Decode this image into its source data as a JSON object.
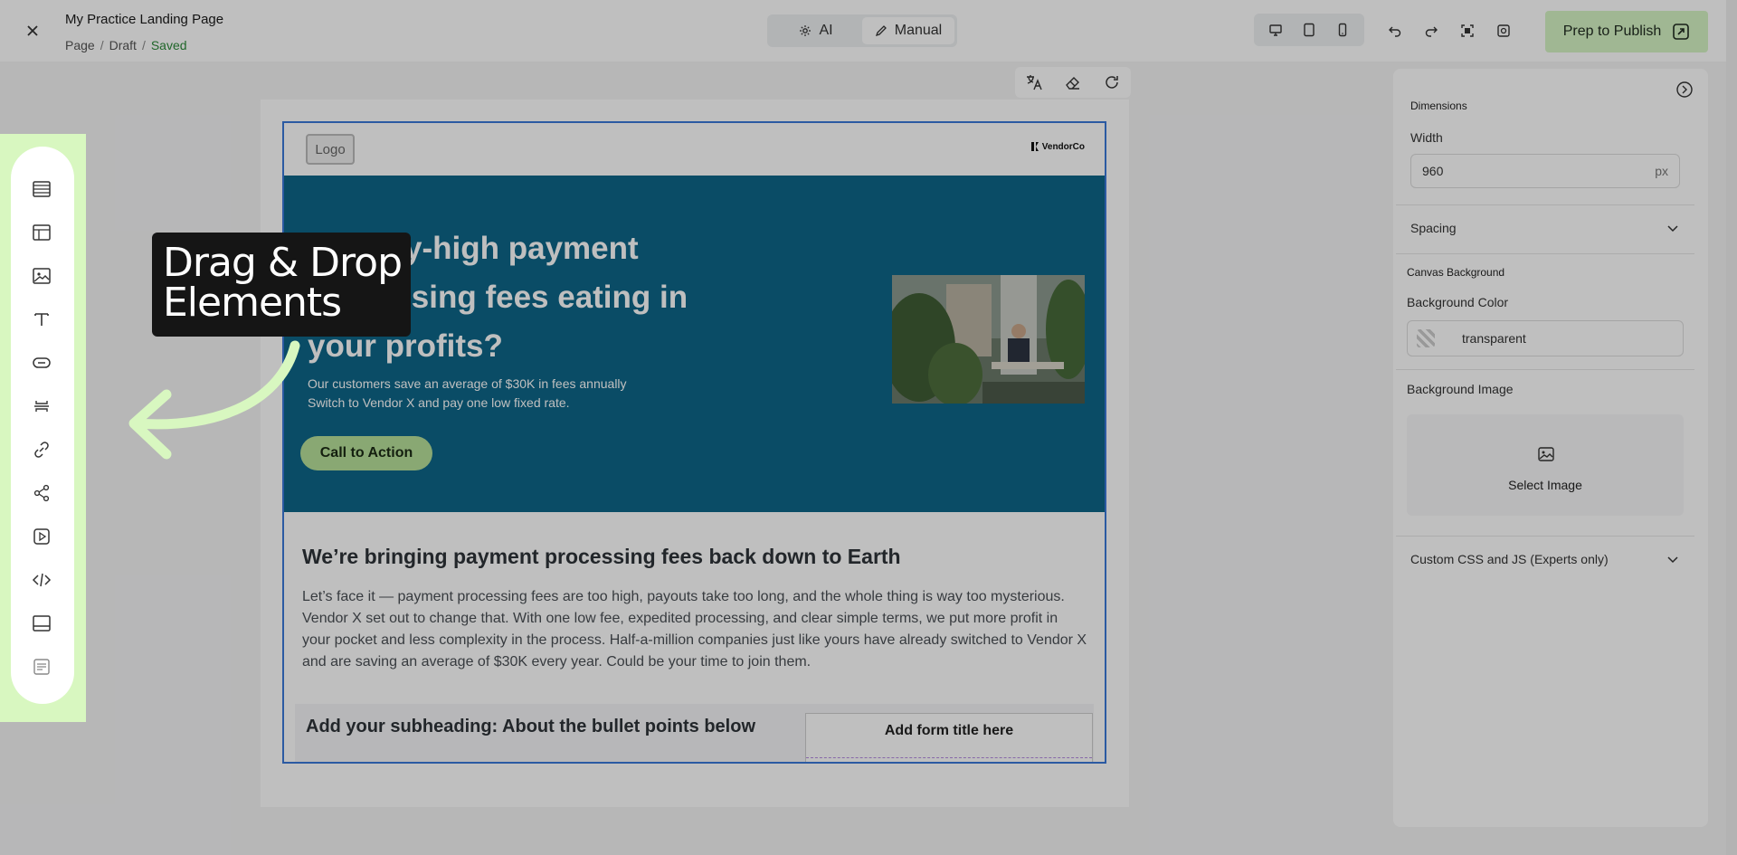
{
  "header": {
    "close_icon": "close-icon",
    "page_title": "My Practice Landing Page",
    "breadcrumb": [
      "Page",
      "Draft",
      "Saved"
    ],
    "breadcrumb_separator": "/",
    "modes": [
      {
        "label": "AI",
        "icon": "sparkle-icon"
      },
      {
        "label": "Manual",
        "icon": "pencil-icon",
        "active": true
      }
    ],
    "devices": [
      "desktop-icon",
      "tablet-icon",
      "mobile-icon"
    ],
    "tools": [
      "undo-icon",
      "redo-icon",
      "fullscreen-icon",
      "preview-icon"
    ],
    "publish_label": "Prep to Publish",
    "publish_color": "#d6f5c5"
  },
  "canvas_tools": [
    "translate-icon",
    "eraser-icon",
    "refresh-icon"
  ],
  "landing": {
    "logo_label": "Logo",
    "vendor_logo": "VendorCo",
    "hero_title": "Are sky-high payment processing fees eating in your profits?",
    "hero_line1": "Our customers save an average of $30K in fees annually",
    "hero_line2": "Switch to Vendor X and pay one low fixed rate.",
    "cta_label": "Call to Action",
    "hero_bg": "#0e6688",
    "section_title": "We’re bringing payment processing fees back down to Earth",
    "section_body": "Let’s face it — payment processing fees are too high, payouts take too long, and the whole thing is way too mysterious. Vendor X set out to change that. With one low fee, expedited processing, and clear simple terms, we put more profit in your pocket and less complexity in the process. Half-a-million companies just like yours have already switched to Vendor X and are saving an average of $30K every year. Could be your time to join them.",
    "subheading": "Add your subheading: About the bullet points below",
    "form_title": "Add form title here"
  },
  "panel": {
    "dimensions_label": "Dimensions",
    "width_label": "Width",
    "width_value": "960",
    "width_unit": "px",
    "spacing_label": "Spacing",
    "canvas_bg_label": "Canvas Background",
    "bg_color_label": "Background Color",
    "bg_color_value": "transparent",
    "bg_image_label": "Background Image",
    "select_image_label": "Select Image",
    "custom_css_label": "Custom CSS and JS  (Experts only)"
  },
  "toolbar": {
    "items": [
      "rows-icon",
      "layout-icon",
      "image-icon",
      "text-icon",
      "button-icon",
      "divider-icon",
      "link-icon",
      "share-icon",
      "video-icon",
      "code-icon",
      "footer-icon",
      "form-icon"
    ],
    "highlight_color": "#d8f7c0"
  },
  "callout": {
    "line1": "Drag & Drop",
    "line2": "Elements"
  }
}
